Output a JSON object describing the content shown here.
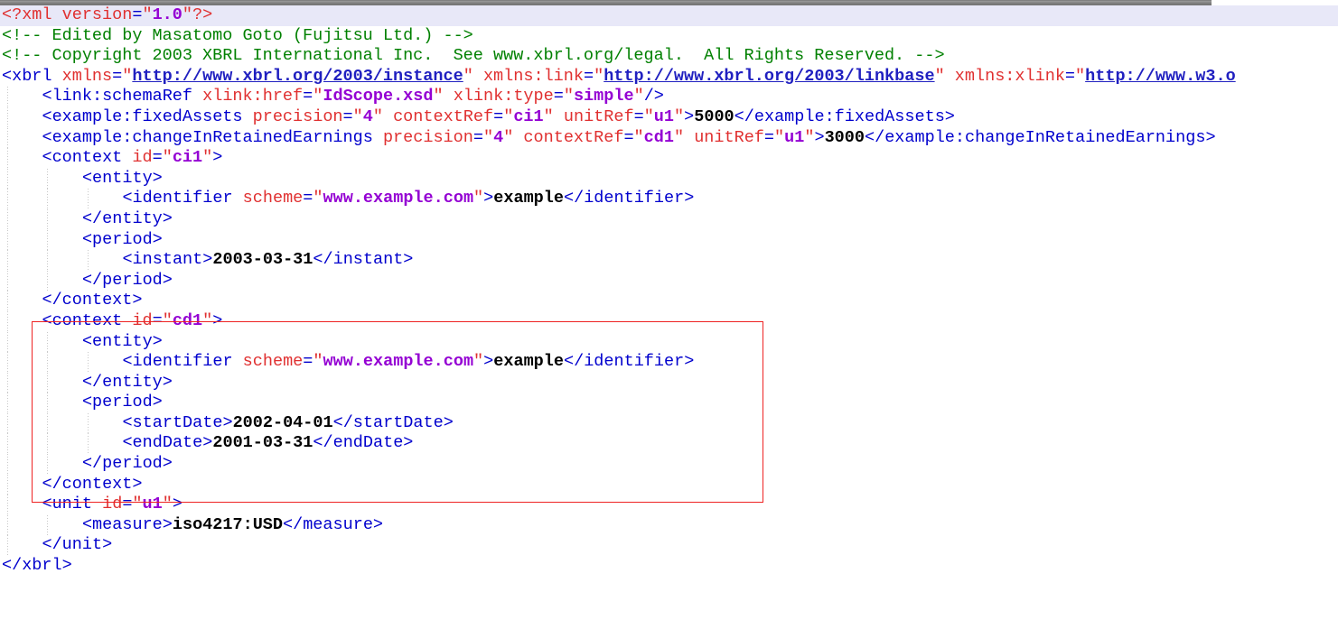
{
  "document": {
    "type": "xml-source-view",
    "encoding_declaration": "<?xml version=\"1.0\"?>",
    "highlighted_line_index": 0
  },
  "colors": {
    "background": "#ffffff",
    "tag": "#0000cd",
    "attribute_name": "#e03030",
    "attribute_value": "#9400d3",
    "url_value": "#2020c0",
    "text_content": "#000000",
    "comment": "#008000",
    "processing_instruction": "#e03030",
    "highlight_row": "#e8e8f8",
    "annotation_box": "#ee2222",
    "indent_guide": "#c8c8c8",
    "scrollbar_track": "#d4d0c8",
    "scrollbar_thumb": "#7d7d7d"
  },
  "annotation": {
    "name": "red-highlight-box",
    "label": "",
    "covers_lines": [
      13,
      14,
      15,
      16,
      17,
      18,
      19,
      20
    ],
    "border_color": "#ee2222"
  },
  "lines": [
    {
      "n": 1,
      "indent": 0,
      "highlighted": true,
      "tokens": [
        {
          "t": "pi",
          "s": "<?xml "
        },
        {
          "t": "attr",
          "s": "version"
        },
        {
          "t": "punct",
          "s": "="
        },
        {
          "t": "quote",
          "s": "\""
        },
        {
          "t": "val",
          "s": "1.0"
        },
        {
          "t": "quote",
          "s": "\""
        },
        {
          "t": "pi",
          "s": "?>"
        }
      ]
    },
    {
      "n": 2,
      "indent": 0,
      "highlighted": false,
      "tokens": [
        {
          "t": "comment",
          "s": "<!-- Edited by Masatomo Goto (Fujitsu Ltd.) -->"
        }
      ]
    },
    {
      "n": 3,
      "indent": 0,
      "highlighted": false,
      "tokens": [
        {
          "t": "comment",
          "s": "<!-- Copyright 2003 XBRL International Inc.  See www.xbrl.org/legal.  All Rights Reserved. -->"
        }
      ]
    },
    {
      "n": 4,
      "indent": 0,
      "highlighted": false,
      "tokens": [
        {
          "t": "tag",
          "s": "<xbrl "
        },
        {
          "t": "attr",
          "s": "xmlns"
        },
        {
          "t": "punct",
          "s": "="
        },
        {
          "t": "quote",
          "s": "\""
        },
        {
          "t": "url",
          "s": "http://www.xbrl.org/2003/instance"
        },
        {
          "t": "quote",
          "s": "\""
        },
        {
          "t": "plain",
          "s": " "
        },
        {
          "t": "attr",
          "s": "xmlns:link"
        },
        {
          "t": "punct",
          "s": "="
        },
        {
          "t": "quote",
          "s": "\""
        },
        {
          "t": "url",
          "s": "http://www.xbrl.org/2003/linkbase"
        },
        {
          "t": "quote",
          "s": "\""
        },
        {
          "t": "plain",
          "s": " "
        },
        {
          "t": "attr",
          "s": "xmlns:xlink"
        },
        {
          "t": "punct",
          "s": "="
        },
        {
          "t": "quote",
          "s": "\""
        },
        {
          "t": "url",
          "s": "http://www.w3.o"
        }
      ]
    },
    {
      "n": 5,
      "indent": 1,
      "highlighted": false,
      "tokens": [
        {
          "t": "tag",
          "s": "<link:schemaRef "
        },
        {
          "t": "attr",
          "s": "xlink:href"
        },
        {
          "t": "punct",
          "s": "="
        },
        {
          "t": "quote",
          "s": "\""
        },
        {
          "t": "val",
          "s": "IdScope.xsd"
        },
        {
          "t": "quote",
          "s": "\""
        },
        {
          "t": "plain",
          "s": " "
        },
        {
          "t": "attr",
          "s": "xlink:type"
        },
        {
          "t": "punct",
          "s": "="
        },
        {
          "t": "quote",
          "s": "\""
        },
        {
          "t": "val",
          "s": "simple"
        },
        {
          "t": "quote",
          "s": "\""
        },
        {
          "t": "tag",
          "s": "/>"
        }
      ]
    },
    {
      "n": 6,
      "indent": 1,
      "highlighted": false,
      "tokens": [
        {
          "t": "tag",
          "s": "<example:fixedAssets "
        },
        {
          "t": "attr",
          "s": "precision"
        },
        {
          "t": "punct",
          "s": "="
        },
        {
          "t": "quote",
          "s": "\""
        },
        {
          "t": "val",
          "s": "4"
        },
        {
          "t": "quote",
          "s": "\""
        },
        {
          "t": "plain",
          "s": " "
        },
        {
          "t": "attr",
          "s": "contextRef"
        },
        {
          "t": "punct",
          "s": "="
        },
        {
          "t": "quote",
          "s": "\""
        },
        {
          "t": "val",
          "s": "ci1"
        },
        {
          "t": "quote",
          "s": "\""
        },
        {
          "t": "plain",
          "s": " "
        },
        {
          "t": "attr",
          "s": "unitRef"
        },
        {
          "t": "punct",
          "s": "="
        },
        {
          "t": "quote",
          "s": "\""
        },
        {
          "t": "val",
          "s": "u1"
        },
        {
          "t": "quote",
          "s": "\""
        },
        {
          "t": "tag",
          "s": ">"
        },
        {
          "t": "text",
          "s": "5000"
        },
        {
          "t": "tag",
          "s": "</example:fixedAssets>"
        }
      ]
    },
    {
      "n": 7,
      "indent": 1,
      "highlighted": false,
      "tokens": [
        {
          "t": "tag",
          "s": "<example:changeInRetainedEarnings "
        },
        {
          "t": "attr",
          "s": "precision"
        },
        {
          "t": "punct",
          "s": "="
        },
        {
          "t": "quote",
          "s": "\""
        },
        {
          "t": "val",
          "s": "4"
        },
        {
          "t": "quote",
          "s": "\""
        },
        {
          "t": "plain",
          "s": " "
        },
        {
          "t": "attr",
          "s": "contextRef"
        },
        {
          "t": "punct",
          "s": "="
        },
        {
          "t": "quote",
          "s": "\""
        },
        {
          "t": "val",
          "s": "cd1"
        },
        {
          "t": "quote",
          "s": "\""
        },
        {
          "t": "plain",
          "s": " "
        },
        {
          "t": "attr",
          "s": "unitRef"
        },
        {
          "t": "punct",
          "s": "="
        },
        {
          "t": "quote",
          "s": "\""
        },
        {
          "t": "val",
          "s": "u1"
        },
        {
          "t": "quote",
          "s": "\""
        },
        {
          "t": "tag",
          "s": ">"
        },
        {
          "t": "text",
          "s": "3000"
        },
        {
          "t": "tag",
          "s": "</example:changeInRetainedEarnings>"
        }
      ]
    },
    {
      "n": 8,
      "indent": 1,
      "highlighted": false,
      "tokens": [
        {
          "t": "tag",
          "s": "<context "
        },
        {
          "t": "attr",
          "s": "id"
        },
        {
          "t": "punct",
          "s": "="
        },
        {
          "t": "quote",
          "s": "\""
        },
        {
          "t": "val",
          "s": "ci1"
        },
        {
          "t": "quote",
          "s": "\""
        },
        {
          "t": "tag",
          "s": ">"
        }
      ]
    },
    {
      "n": 9,
      "indent": 2,
      "highlighted": false,
      "tokens": [
        {
          "t": "tag",
          "s": "<entity>"
        }
      ]
    },
    {
      "n": 10,
      "indent": 3,
      "highlighted": false,
      "tokens": [
        {
          "t": "tag",
          "s": "<identifier "
        },
        {
          "t": "attr",
          "s": "scheme"
        },
        {
          "t": "punct",
          "s": "="
        },
        {
          "t": "quote",
          "s": "\""
        },
        {
          "t": "val",
          "s": "www.example.com"
        },
        {
          "t": "quote",
          "s": "\""
        },
        {
          "t": "tag",
          "s": ">"
        },
        {
          "t": "text",
          "s": "example"
        },
        {
          "t": "tag",
          "s": "</identifier>"
        }
      ]
    },
    {
      "n": 11,
      "indent": 2,
      "highlighted": false,
      "tokens": [
        {
          "t": "tag",
          "s": "</entity>"
        }
      ]
    },
    {
      "n": 12,
      "indent": 2,
      "highlighted": false,
      "tokens": [
        {
          "t": "tag",
          "s": "<period>"
        }
      ]
    },
    {
      "n": 13,
      "indent": 3,
      "highlighted": false,
      "tokens": [
        {
          "t": "tag",
          "s": "<instant>"
        },
        {
          "t": "text",
          "s": "2003-03-31"
        },
        {
          "t": "tag",
          "s": "</instant>"
        }
      ]
    },
    {
      "n": 14,
      "indent": 2,
      "highlighted": false,
      "tokens": [
        {
          "t": "tag",
          "s": "</period>"
        }
      ]
    },
    {
      "n": 15,
      "indent": 1,
      "highlighted": false,
      "tokens": [
        {
          "t": "tag",
          "s": "</context>"
        }
      ]
    },
    {
      "n": 16,
      "indent": 1,
      "highlighted": false,
      "tokens": [
        {
          "t": "tag",
          "s": "<context "
        },
        {
          "t": "attr",
          "s": "id"
        },
        {
          "t": "punct",
          "s": "="
        },
        {
          "t": "quote",
          "s": "\""
        },
        {
          "t": "val",
          "s": "cd1"
        },
        {
          "t": "quote",
          "s": "\""
        },
        {
          "t": "tag",
          "s": ">"
        }
      ]
    },
    {
      "n": 17,
      "indent": 2,
      "highlighted": false,
      "tokens": [
        {
          "t": "tag",
          "s": "<entity>"
        }
      ]
    },
    {
      "n": 18,
      "indent": 3,
      "highlighted": false,
      "tokens": [
        {
          "t": "tag",
          "s": "<identifier "
        },
        {
          "t": "attr",
          "s": "scheme"
        },
        {
          "t": "punct",
          "s": "="
        },
        {
          "t": "quote",
          "s": "\""
        },
        {
          "t": "val",
          "s": "www.example.com"
        },
        {
          "t": "quote",
          "s": "\""
        },
        {
          "t": "tag",
          "s": ">"
        },
        {
          "t": "text",
          "s": "example"
        },
        {
          "t": "tag",
          "s": "</identifier>"
        }
      ]
    },
    {
      "n": 19,
      "indent": 2,
      "highlighted": false,
      "tokens": [
        {
          "t": "tag",
          "s": "</entity>"
        }
      ]
    },
    {
      "n": 20,
      "indent": 2,
      "highlighted": false,
      "tokens": [
        {
          "t": "tag",
          "s": "<period>"
        }
      ]
    },
    {
      "n": 21,
      "indent": 3,
      "highlighted": false,
      "tokens": [
        {
          "t": "tag",
          "s": "<startDate>"
        },
        {
          "t": "text",
          "s": "2002-04-01"
        },
        {
          "t": "tag",
          "s": "</startDate>"
        }
      ]
    },
    {
      "n": 22,
      "indent": 3,
      "highlighted": false,
      "tokens": [
        {
          "t": "tag",
          "s": "<endDate>"
        },
        {
          "t": "text",
          "s": "2001-03-31"
        },
        {
          "t": "tag",
          "s": "</endDate>"
        }
      ]
    },
    {
      "n": 23,
      "indent": 2,
      "highlighted": false,
      "tokens": [
        {
          "t": "tag",
          "s": "</period>"
        }
      ]
    },
    {
      "n": 24,
      "indent": 1,
      "highlighted": false,
      "tokens": [
        {
          "t": "tag",
          "s": "</context>"
        }
      ]
    },
    {
      "n": 25,
      "indent": 1,
      "highlighted": false,
      "tokens": [
        {
          "t": "tag",
          "s": "<unit "
        },
        {
          "t": "attr",
          "s": "id"
        },
        {
          "t": "punct",
          "s": "="
        },
        {
          "t": "quote",
          "s": "\""
        },
        {
          "t": "val",
          "s": "u1"
        },
        {
          "t": "quote",
          "s": "\""
        },
        {
          "t": "tag",
          "s": ">"
        }
      ]
    },
    {
      "n": 26,
      "indent": 2,
      "highlighted": false,
      "tokens": [
        {
          "t": "tag",
          "s": "<measure>"
        },
        {
          "t": "text",
          "s": "iso4217:USD"
        },
        {
          "t": "tag",
          "s": "</measure>"
        }
      ]
    },
    {
      "n": 27,
      "indent": 1,
      "highlighted": false,
      "tokens": [
        {
          "t": "tag",
          "s": "</unit>"
        }
      ]
    },
    {
      "n": 28,
      "indent": 0,
      "highlighted": false,
      "tokens": [
        {
          "t": "tag",
          "s": "</xbrl>"
        }
      ]
    }
  ]
}
